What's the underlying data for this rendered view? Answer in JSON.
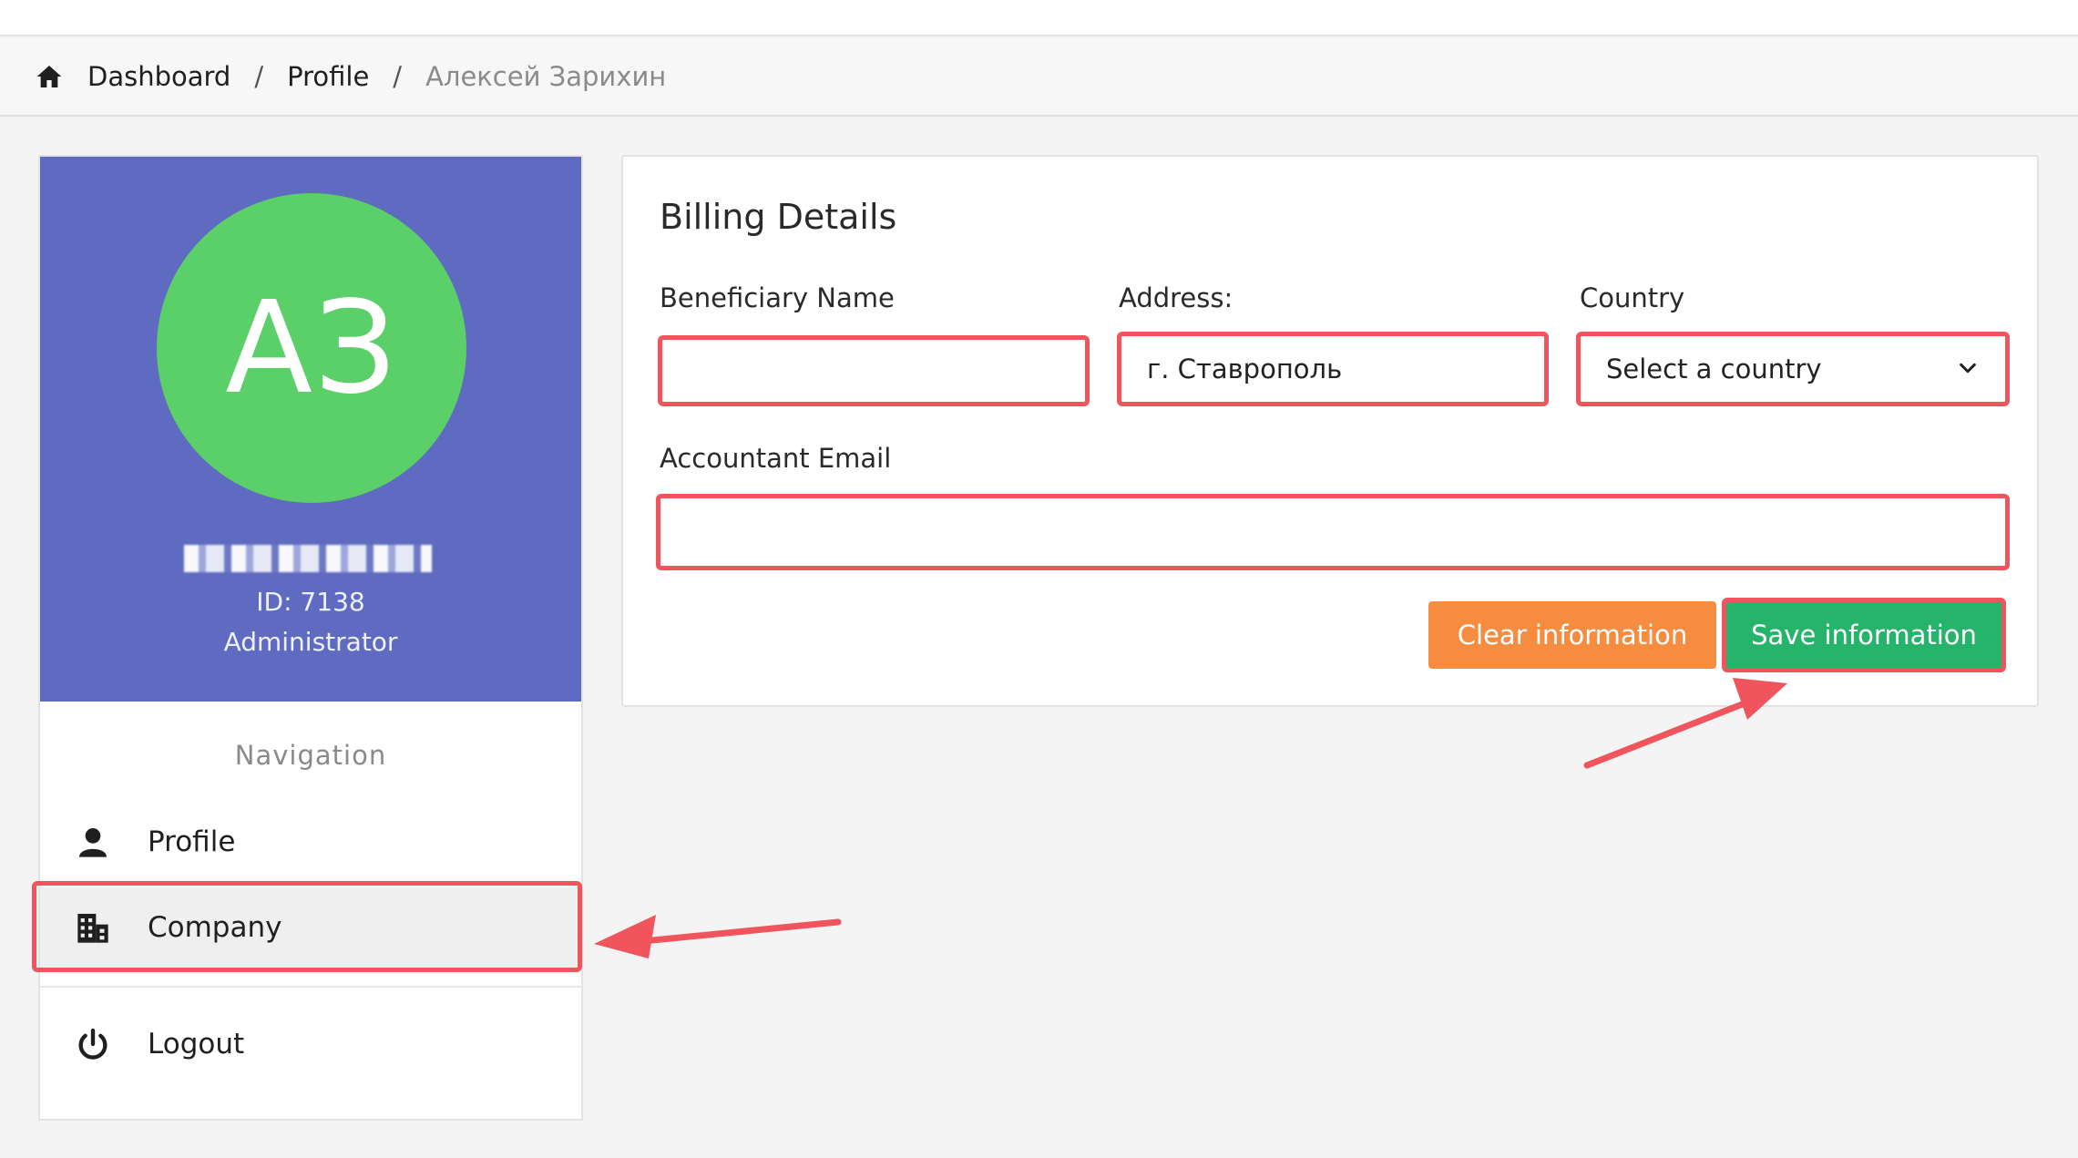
{
  "breadcrumb": {
    "items": [
      "Dashboard",
      "Profile"
    ],
    "separator": "/",
    "current": "Алексей Зарихин"
  },
  "profile": {
    "avatar_initials": "АЗ",
    "id_text": "ID: 7138",
    "role": "Administrator",
    "avatar_color": "#5bcf68",
    "header_color": "#5e6bc0"
  },
  "navigation": {
    "title": "Navigation",
    "items": [
      {
        "label": "Profile",
        "icon": "user-icon"
      },
      {
        "label": "Company",
        "icon": "building-icon",
        "active": true
      },
      {
        "label": "Logout",
        "icon": "power-icon"
      }
    ]
  },
  "billing": {
    "title": "Billing Details",
    "beneficiary_label": "Beneficiary Name",
    "beneficiary_value": "",
    "address_label": "Address:",
    "address_value": "г. Ставрополь",
    "country_label": "Country",
    "country_value": "Select a country",
    "email_label": "Accountant Email",
    "email_value": "",
    "clear_label": "Clear information",
    "save_label": "Save information"
  },
  "colors": {
    "highlight": "#f0545c",
    "clear_button": "#f58c40",
    "save_button": "#26b46a"
  }
}
